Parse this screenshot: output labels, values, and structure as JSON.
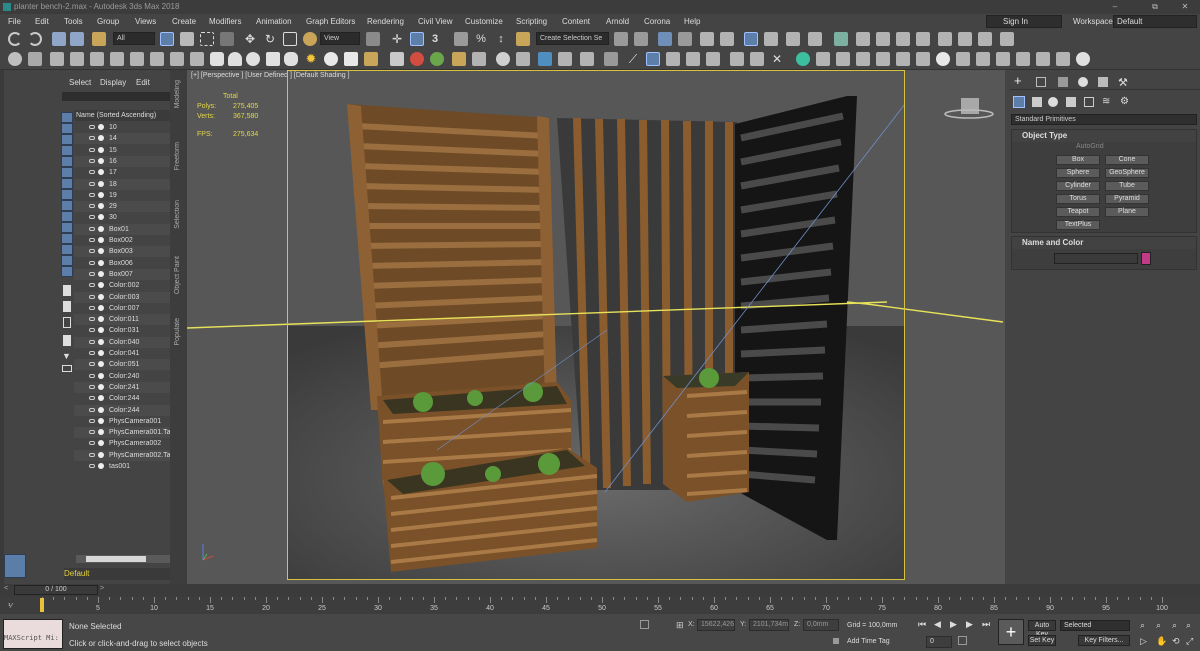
{
  "window": {
    "title": "planter bench-2.max - Autodesk 3ds Max 2018",
    "min": "–",
    "max": "⧉",
    "close": "✕"
  },
  "menu": [
    "File",
    "Edit",
    "Tools",
    "Group",
    "Views",
    "Create",
    "Modifiers",
    "Animation",
    "Graph Editors",
    "Rendering",
    "Civil View",
    "Customize",
    "Scripting",
    "Content",
    "Arnold",
    "Corona",
    "Help"
  ],
  "signin": "Sign In",
  "workspaces_label": "Workspaces:",
  "workspaces_value": "Default",
  "toolbar": {
    "filter": "All",
    "refcoord": "View",
    "selset": "Create Selection Se"
  },
  "scene_explorer": {
    "tabs": [
      "Select",
      "Display",
      "Edit"
    ],
    "column_header": "Name (Sorted Ascending)",
    "items": [
      "10",
      "14",
      "15",
      "16",
      "17",
      "18",
      "19",
      "29",
      "30",
      "Box01",
      "Box002",
      "Box003",
      "Box006",
      "Box007",
      "Color:002",
      "Color:003",
      "Color:007",
      "Color:011",
      "Color:031",
      "Color:040",
      "Color:041",
      "Color:051",
      "Color:240",
      "Color:241",
      "Color:244",
      "Color:244",
      "PhysCamera001",
      "PhysCamera001.Ta",
      "PhysCamera002",
      "PhysCamera002.Ta",
      "tas001"
    ],
    "layer": "Default"
  },
  "side_tabs": [
    "Modeling",
    "Freeform",
    "Selection",
    "Object Paint",
    "Populate"
  ],
  "viewport": {
    "label": "[+] [Perspective ] [User Defined ] [Default Shading ]",
    "stats": {
      "total_label": "Total",
      "polys_label": "Polys:",
      "polys": "275,405",
      "verts_label": "Verts:",
      "verts": "367,580",
      "fps_label": "FPS:",
      "fps": "275,634"
    }
  },
  "command_panel": {
    "dropdown": "Standard Primitives",
    "object_type": "Object Type",
    "autogrid": "AutoGrid",
    "buttons": [
      "Box",
      "Cone",
      "Sphere",
      "GeoSphere",
      "Cylinder",
      "Tube",
      "Torus",
      "Pyramid",
      "Teapot",
      "Plane",
      "TextPlus"
    ],
    "name_and_color": "Name and Color",
    "swatch_color": "#c33a86"
  },
  "timeslider": {
    "frame": "0 / 100",
    "left": "<",
    "right": ">"
  },
  "trackbar": {
    "ticks": [
      "0",
      "5",
      "10",
      "15",
      "20",
      "25",
      "30",
      "35",
      "40",
      "45",
      "50",
      "55",
      "60",
      "65",
      "70",
      "75",
      "80",
      "85",
      "90",
      "95",
      "100"
    ]
  },
  "status": {
    "maxscript": "MAXScript Mi:",
    "selected": "None Selected",
    "prompt": "Click or click-and-drag to select objects",
    "x_label": "X:",
    "x": "15622,426",
    "y_label": "Y:",
    "y": "2101,734m",
    "z_label": "Z:",
    "z": "0,0mm",
    "grid": "Grid = 100,0mm",
    "add_time_tag": "Add Time Tag",
    "auto_key": "Auto Key",
    "set_key": "Set Key",
    "selected_dd": "Selected",
    "key_filters": "Key Filters...",
    "frame_field": "0"
  }
}
